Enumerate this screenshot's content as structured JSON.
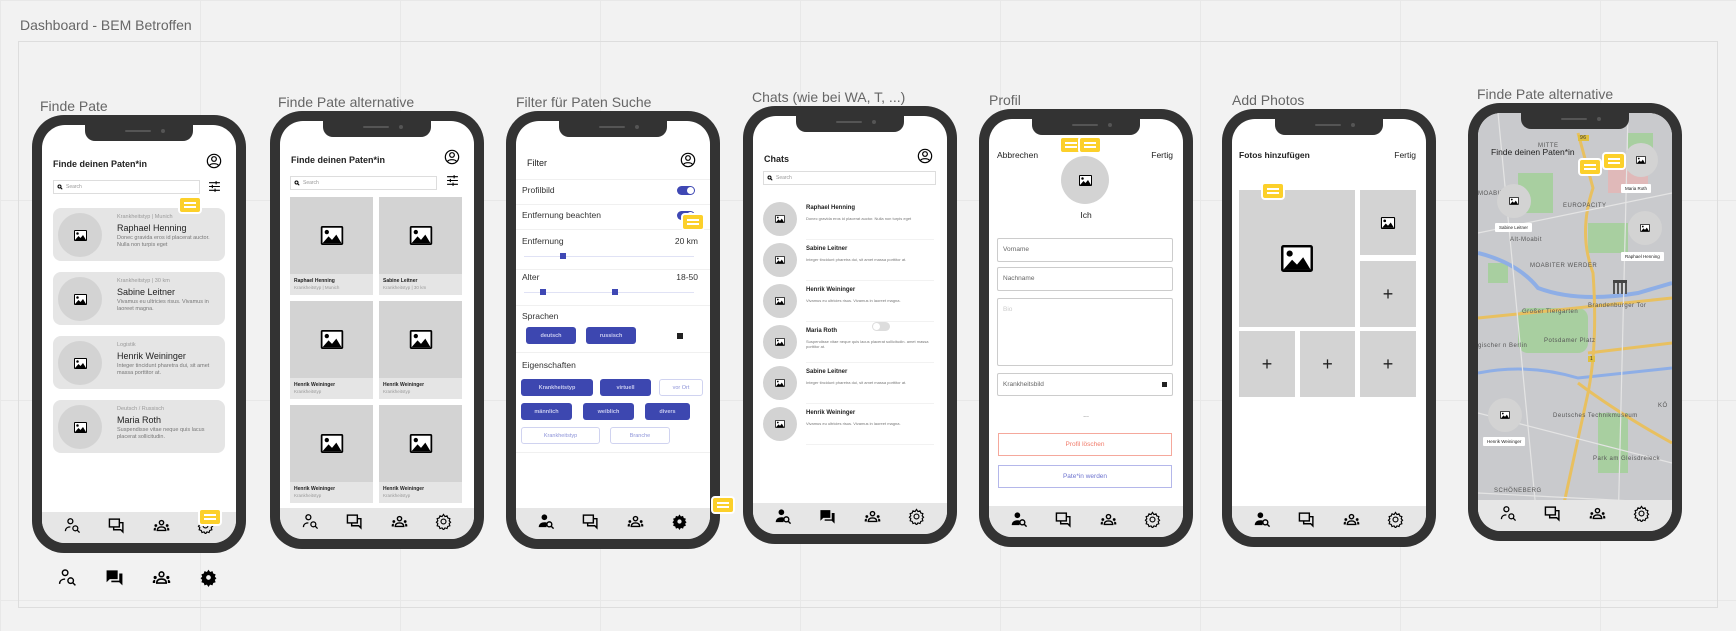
{
  "board": {
    "title": "Dashboard - BEM Betroffen"
  },
  "colors": {
    "accent": "#3f48b4",
    "danger": "#f07b6a",
    "comment": "#fcd02a",
    "bezel": "#333333"
  },
  "nav_icons": [
    "person-search-icon",
    "chat-icon",
    "group-icon",
    "gear-icon"
  ],
  "screens": {
    "finde_pate": {
      "label": "Finde Pate",
      "title": "Finde deinen Paten*in",
      "search_placeholder": "Search",
      "cards": [
        {
          "meta": "Krankheitstyp | Munich",
          "name": "Raphael Henning",
          "desc": "Donec gravida eros id placerat auctor. Nulla non turpis eget"
        },
        {
          "meta": "Krankheitstyp | 30 km",
          "name": "Sabine Leitner",
          "desc": "Vivamus eu ultricies risus. Vivamus in laoreet magna."
        },
        {
          "meta": "Logistik",
          "name": "Henrik Weininger",
          "desc": "Integer tincidunt pharetra dui, sit amet massa porttitor at."
        },
        {
          "meta": "Deutsch / Russisch",
          "name": "Maria Roth",
          "desc": "Suspendisse vitae neque quis lacus placerat sollicitudin."
        }
      ]
    },
    "finde_pate_alt": {
      "label": "Finde Pate alternative",
      "title": "Finde deinen Paten*in",
      "search_placeholder": "Search",
      "tiles": [
        {
          "name": "Raphael Henning",
          "sub": "Krankheitstyp | Munich"
        },
        {
          "name": "Sabine Leitner",
          "sub": "Krankheitstyp | 30 km"
        },
        {
          "name": "Henrik Weininger",
          "sub": "Krankheitstyp"
        },
        {
          "name": "Henrik Weininger",
          "sub": "Krankheitstyp"
        },
        {
          "name": "Henrik Weininger",
          "sub": "Krankheitstyp"
        },
        {
          "name": "Henrik Weininger",
          "sub": "Krankheitstyp"
        }
      ]
    },
    "filter": {
      "label": "Filter für Paten Suche",
      "title": "Filter",
      "profilbild": {
        "label": "Profilbild",
        "on": true
      },
      "entfernung_beachten": {
        "label": "Entfernung beachten",
        "on": true
      },
      "entfernung": {
        "label": "Entfernung",
        "value": "20 km"
      },
      "alter": {
        "label": "Alter",
        "value": "18-50"
      },
      "sprachen": {
        "label": "Sprachen",
        "chips": [
          "deutsch",
          "russisch"
        ]
      },
      "eigenschaften": {
        "label": "Eigenschaften",
        "chips": [
          {
            "text": "Krankheitstyp",
            "selected": true
          },
          {
            "text": "virtuell",
            "selected": true
          },
          {
            "text": "vor Ort",
            "selected": false
          },
          {
            "text": "männlich",
            "selected": true
          },
          {
            "text": "weiblich",
            "selected": true
          },
          {
            "text": "divers",
            "selected": true
          },
          {
            "text": "Krankheitstyp",
            "selected": false
          },
          {
            "text": "Branche",
            "selected": false
          }
        ]
      }
    },
    "chats": {
      "label": "Chats (wie bei WA, T, ...)",
      "title": "Chats",
      "search_placeholder": "Search",
      "items": [
        {
          "name": "Raphael Henning",
          "msg": "Donec gravida eros id placerat auctor. Nulla non turpis eget"
        },
        {
          "name": "Sabine Leitner",
          "msg": "Integer tincidunt pharetra dui, sit amet massa porttitor at."
        },
        {
          "name": "Henrik Weininger",
          "msg": "Vivamus eu ultricies risus. Vivamus in laoreet magna."
        },
        {
          "name": "Maria Roth",
          "msg": "Suspendisse vitae neque quis lacus placerat sollicitudin. amet massa porttitor at."
        },
        {
          "name": "Sabine Leitner",
          "msg": "Integer tincidunt pharetra dui, sit amet massa porttitor at."
        },
        {
          "name": "Henrik Weininger",
          "msg": "Vivamus eu ultricies risus. Vivamus in laoreet magna."
        }
      ]
    },
    "profil": {
      "label": "Profil",
      "cancel": "Abbrechen",
      "done": "Fertig",
      "avatar_name": "Ich",
      "vorname_placeholder": "Vorname",
      "nachname_placeholder": "Nachname",
      "bio_placeholder": "Bio",
      "krankheitsbild": "Krankheitsbild",
      "more": "...",
      "delete": "Profil löschen",
      "become": "Pate*in werden"
    },
    "photos": {
      "label": "Add Photos",
      "title": "Fotos hinzufügen",
      "done": "Fertig",
      "add_symbol": "+"
    },
    "map": {
      "label": "Finde Pate alternative",
      "title": "Finde deinen Paten*in",
      "markers": [
        "Maria Roth",
        "Sabine Leitner",
        "Raphael Henning",
        "Henrik Weininger"
      ],
      "places": [
        "MITTE",
        "EUROPACITY",
        "MOABIT",
        "Alt-Moabit",
        "MOABITER WERDER",
        "Brandenburger Tor",
        "Großer Tiergarten",
        "Potsdamer Platz",
        "gischer n Berlin",
        "Deutsches Technikmuseum",
        "Park am Gleisdreieck",
        "SCHÖNEBERG",
        "KÖ",
        "96",
        "1"
      ]
    }
  }
}
